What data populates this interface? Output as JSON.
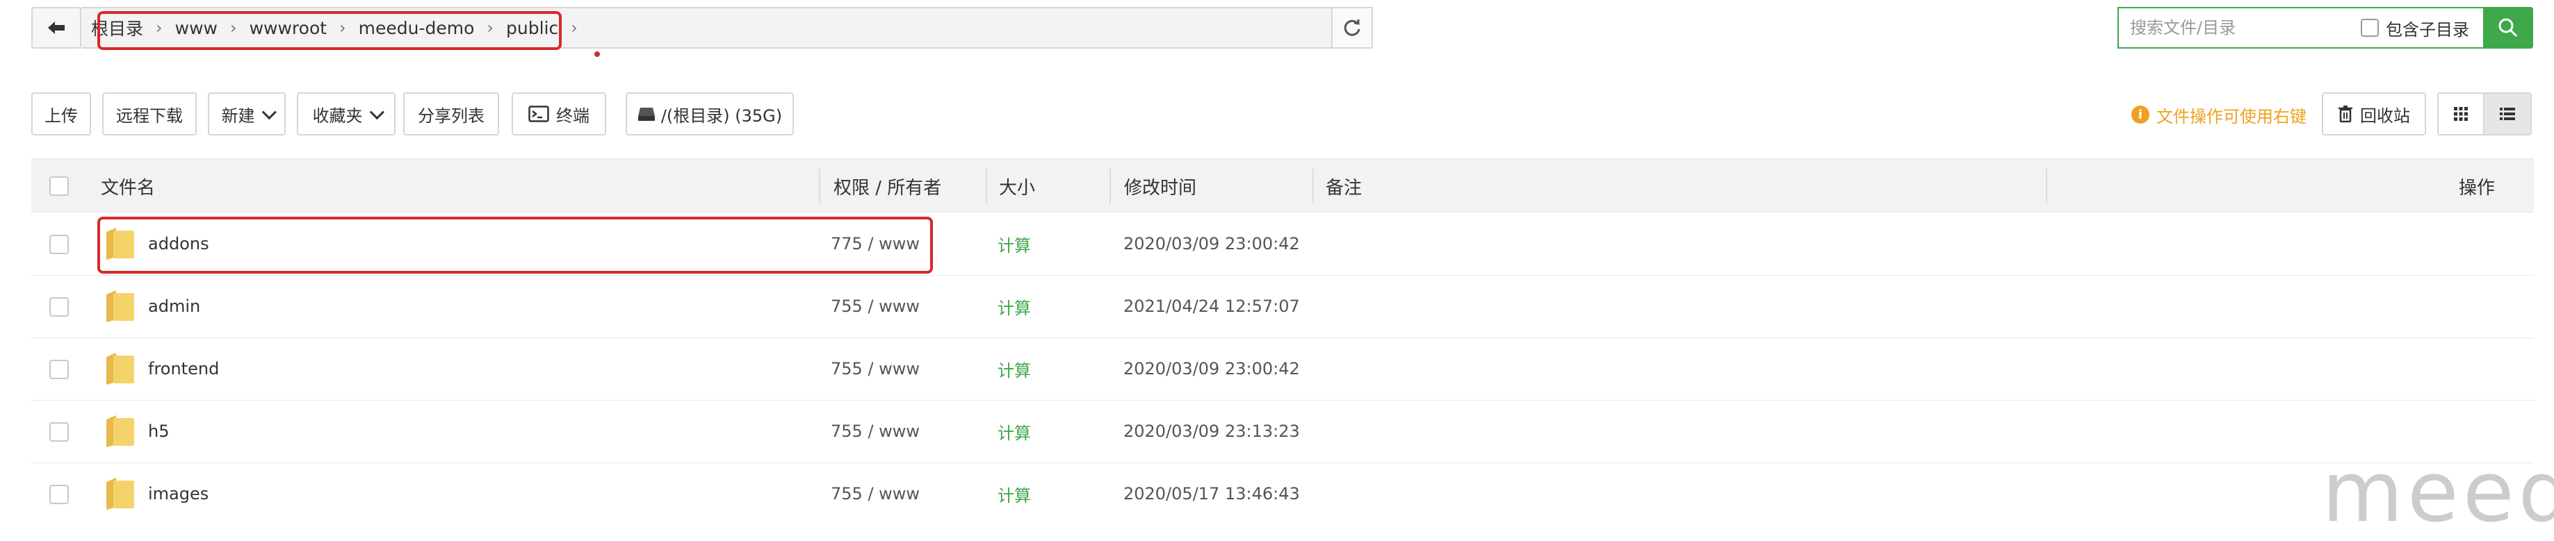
{
  "path_bar": {
    "crumbs": [
      "根目录",
      "www",
      "wwwroot",
      "meedu-demo",
      "public"
    ]
  },
  "search": {
    "placeholder": "搜索文件/目录",
    "include_sub_label": "包含子目录"
  },
  "toolbar": {
    "upload": "上传",
    "remote_download": "远程下载",
    "new": "新建",
    "favorites": "收藏夹",
    "share_list": "分享列表",
    "terminal": "终端",
    "disk": "/(根目录) (35G)",
    "tip": "文件操作可使用右键",
    "recycle_bin": "回收站"
  },
  "table": {
    "headers": {
      "name": "文件名",
      "perm_owner": "权限 / 所有者",
      "size": "大小",
      "mtime": "修改时间",
      "remark": "备注",
      "actions": "操作"
    },
    "rows": [
      {
        "name": "addons",
        "perm": "775 / www",
        "size": "计算",
        "mtime": "2020/03/09 23:00:42"
      },
      {
        "name": "admin",
        "perm": "755 / www",
        "size": "计算",
        "mtime": "2021/04/24 12:57:07"
      },
      {
        "name": "frontend",
        "perm": "755 / www",
        "size": "计算",
        "mtime": "2020/03/09 23:00:42"
      },
      {
        "name": "h5",
        "perm": "755 / www",
        "size": "计算",
        "mtime": "2020/03/09 23:13:23"
      },
      {
        "name": "images",
        "perm": "755 / www",
        "size": "计算",
        "mtime": "2020/05/17 13:46:43"
      }
    ]
  },
  "watermark": "meedu",
  "colors": {
    "accent_green": "#3ea84b",
    "annotation_red": "#d52a2a",
    "tip_orange": "#f0a020",
    "folder_yellow": "#f5d36b"
  }
}
